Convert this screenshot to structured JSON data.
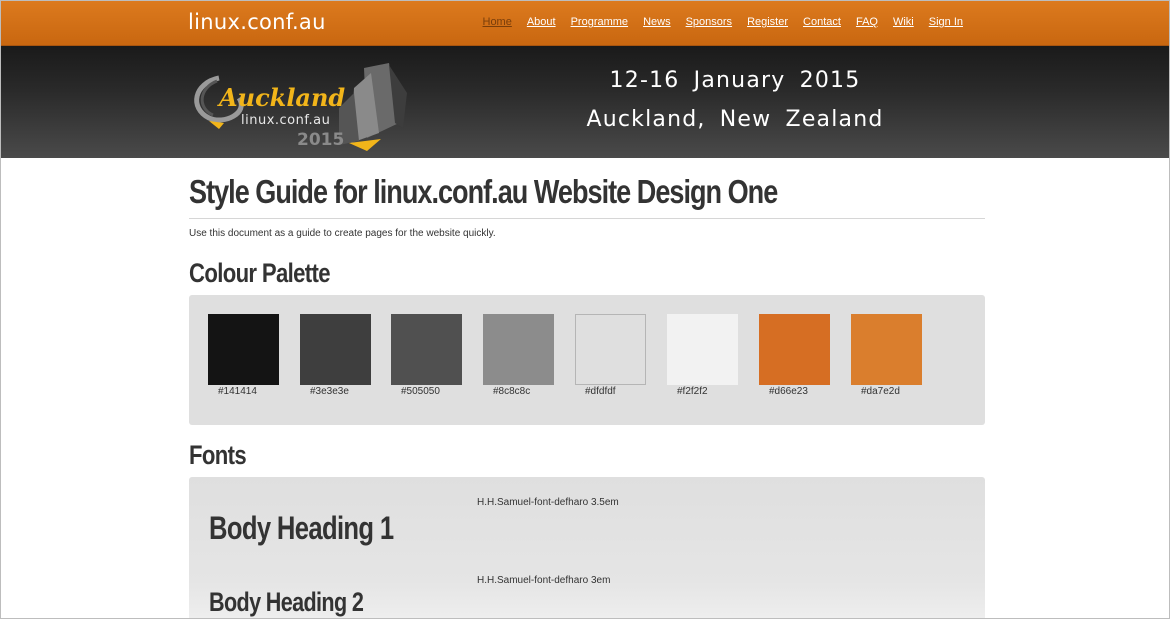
{
  "header": {
    "brand": "linux.conf.au",
    "nav": [
      {
        "label": "Home",
        "active": true
      },
      {
        "label": "About"
      },
      {
        "label": "Programme"
      },
      {
        "label": "News"
      },
      {
        "label": "Sponsors"
      },
      {
        "label": "Register"
      },
      {
        "label": "Contact"
      },
      {
        "label": "FAQ"
      },
      {
        "label": "Wiki"
      },
      {
        "label": "Sign In"
      }
    ]
  },
  "banner": {
    "logo_city": "Auckland",
    "logo_site": "linux.conf.au",
    "logo_year": "2015",
    "dates": "12-16 January 2015",
    "place": "Auckland, New Zealand"
  },
  "main": {
    "title": "Style Guide for linux.conf.au Website Design One",
    "intro": "Use this document as a guide to create pages for the website quickly.",
    "palette_heading": "Colour Palette",
    "palette": [
      {
        "hex": "#141414",
        "label": "#141414"
      },
      {
        "hex": "#3e3e3e",
        "label": "#3e3e3e"
      },
      {
        "hex": "#505050",
        "label": "#505050"
      },
      {
        "hex": "#8c8c8c",
        "label": "#8c8c8c"
      },
      {
        "hex": "#dfdfdf",
        "label": "#dfdfdf"
      },
      {
        "hex": "#f2f2f2",
        "label": "#f2f2f2"
      },
      {
        "hex": "#d66e23",
        "label": "#d66e23"
      },
      {
        "hex": "#da7e2d",
        "label": "#da7e2d"
      }
    ],
    "fonts_heading": "Fonts",
    "fonts": [
      {
        "sample": "Body Heading 1",
        "spec": "H.H.Samuel-font-defharo 3.5em"
      },
      {
        "sample": "Body Heading 2",
        "spec": "H.H.Samuel-font-defharo 3em"
      }
    ]
  },
  "colors": {
    "accent": "#d66e23",
    "nav_active": "#7a3e0a",
    "banner_dark": "#1a1a1a"
  }
}
